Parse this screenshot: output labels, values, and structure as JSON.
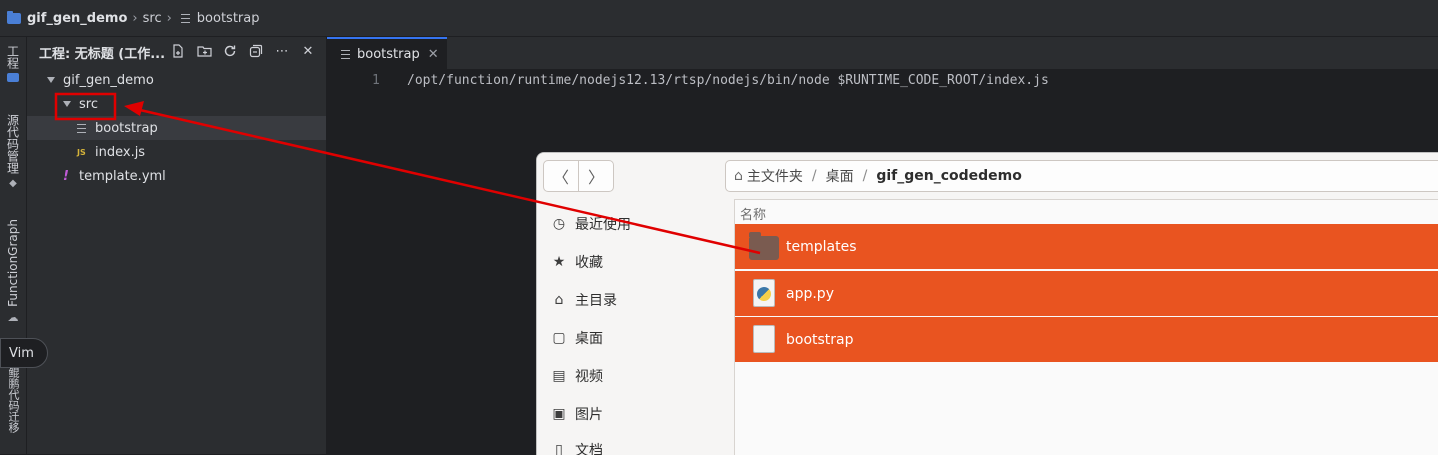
{
  "topbar": {
    "project": "gif_gen_demo",
    "folder": "src",
    "file": "bootstrap"
  },
  "activity": {
    "project_tab": "工程",
    "vcs_tab": "源代码管理",
    "functiongraph_tab": "FunctionGraph",
    "migrate_tab": "鲲鹏代码迁移",
    "vim_tooltip": "Vim"
  },
  "project_panel": {
    "title": "工程: 无标题 (工作...",
    "tree": [
      {
        "label": "gif_gen_demo",
        "type": "folder"
      },
      {
        "label": "src",
        "type": "folder"
      },
      {
        "label": "bootstrap",
        "type": "file"
      },
      {
        "label": "index.js",
        "type": "js"
      },
      {
        "label": "template.yml",
        "type": "yml"
      }
    ],
    "js_badge": "JS",
    "yml_badge": "!"
  },
  "editor": {
    "tab_label": "bootstrap",
    "line_number": "1",
    "code_line": "/opt/function/runtime/nodejs12.13/rtsp/nodejs/bin/node $RUNTIME_CODE_ROOT/index.js"
  },
  "file_manager": {
    "path": [
      "主文件夹",
      "桌面",
      "gif_gen_codedemo"
    ],
    "column_name": "名称",
    "sidebar": [
      {
        "label": "最近使用",
        "icon": "clock-icon"
      },
      {
        "label": "收藏",
        "icon": "star-icon"
      },
      {
        "label": "主目录",
        "icon": "home-icon"
      },
      {
        "label": "桌面",
        "icon": "desktop-icon"
      },
      {
        "label": "视频",
        "icon": "video-icon"
      },
      {
        "label": "图片",
        "icon": "picture-icon"
      },
      {
        "label": "文档",
        "icon": "document-icon"
      }
    ],
    "files": [
      {
        "label": "templates",
        "icon": "folder-icon"
      },
      {
        "label": "app.py",
        "icon": "python-file-icon"
      },
      {
        "label": "bootstrap",
        "icon": "text-file-icon"
      }
    ],
    "selection_color": "#e95420"
  },
  "annotation": {
    "color": "#e00000"
  }
}
